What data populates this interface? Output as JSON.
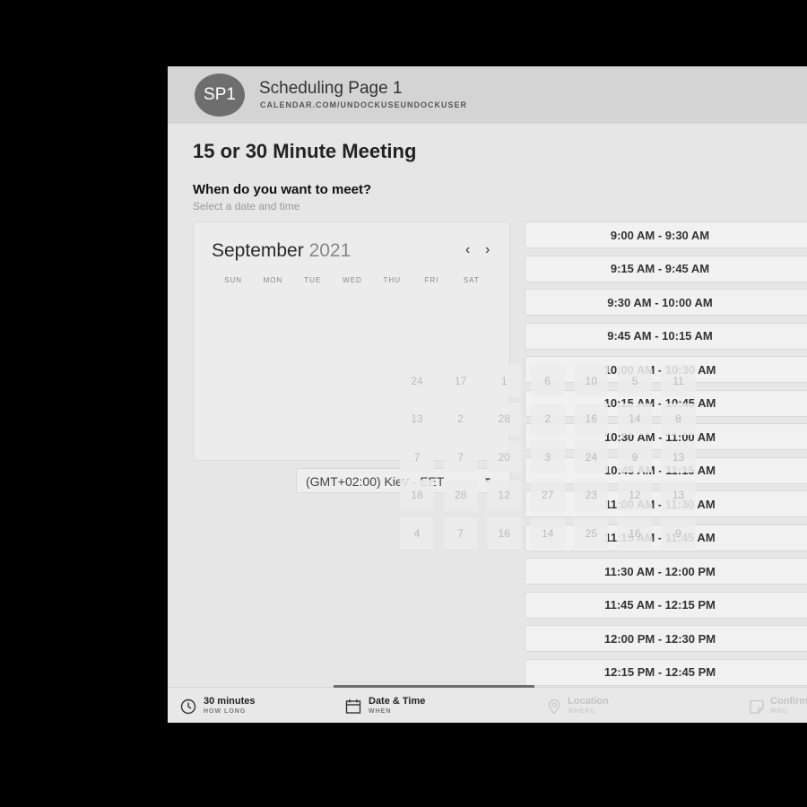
{
  "header": {
    "avatar_initials": "SP1",
    "page_name": "Scheduling Page 1",
    "page_url": "CALENDAR.COM/UNDOCKUSEUNDOCKUSER"
  },
  "main": {
    "meeting_title": "15 or 30 Minute Meeting",
    "question": "When do you want to meet?",
    "subtitle": "Select a date and time"
  },
  "calendar": {
    "month": "September",
    "year": "2021",
    "weekdays": [
      "SUN",
      "MON",
      "TUE",
      "WED",
      "THU",
      "FRI",
      "SAT"
    ]
  },
  "timezone": {
    "value": "(GMT+02:00) Kiev - EET"
  },
  "time_slots": [
    "9:00 AM - 9:30 AM",
    "9:15 AM - 9:45 AM",
    "9:30 AM - 10:00 AM",
    "9:45 AM - 10:15 AM",
    "10:00 AM - 10:30 AM",
    "10:15 AM - 10:45 AM",
    "10:30 AM - 11:00 AM",
    "10:45 AM - 11:15 AM",
    "11:00 AM - 11:30 AM",
    "11:15 AM - 11:45 AM",
    "11:30 AM - 12:00 PM",
    "11:45 AM - 12:15 PM",
    "12:00 PM - 12:30 PM",
    "12:15 PM - 12:45 PM"
  ],
  "overlay_numbers": [
    [
      "24",
      "17",
      "1",
      "6",
      "10",
      "5",
      "11"
    ],
    [
      "13",
      "2",
      "28",
      "2",
      "16",
      "14",
      "8"
    ],
    [
      "7",
      "7",
      "20",
      "3",
      "24",
      "9",
      "13"
    ],
    [
      "18",
      "28",
      "12",
      "27",
      "23",
      "12",
      "13"
    ],
    [
      "4",
      "7",
      "16",
      "14",
      "25",
      "16",
      "9"
    ]
  ],
  "footer": {
    "steps": [
      {
        "label": "30 minutes",
        "sub": "HOW LONG"
      },
      {
        "label": "Date & Time",
        "sub": "WHEN"
      },
      {
        "label": "Location",
        "sub": "WHERE"
      },
      {
        "label": "Confirm",
        "sub": "WHO"
      }
    ]
  }
}
